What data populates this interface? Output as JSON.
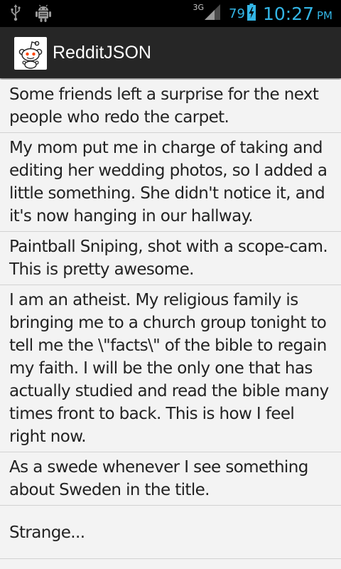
{
  "status_bar": {
    "network_type": "3G",
    "battery_level": "79",
    "time": "10:27",
    "ampm": "PM",
    "left_icons": [
      "usb-icon",
      "android-debug-icon"
    ],
    "right_icons": [
      "signal-icon",
      "battery-icon"
    ],
    "accent_color": "#33b5e5"
  },
  "action_bar": {
    "title": "RedditJSON",
    "icon": "reddit-alien-icon",
    "background": "#262626"
  },
  "posts": [
    {
      "title": "Some friends left a surprise for the next people who redo the carpet."
    },
    {
      "title": "My mom put me in charge of taking and editing her wedding photos, so I added a little something. She didn't notice it, and it's now hanging in our hallway."
    },
    {
      "title": "Paintball Sniping, shot with a scope-cam. This is pretty awesome."
    },
    {
      "title": "I am an atheist. My religious family is bringing me to a church group tonight to tell me the \\\"facts\\\" of the bible to regain my faith. I will be the only one that has actually studied and read the bible many times front to back. This is how I feel right now."
    },
    {
      "title": "As a swede whenever I see something about Sweden in the title."
    },
    {
      "title": "Strange..."
    }
  ]
}
